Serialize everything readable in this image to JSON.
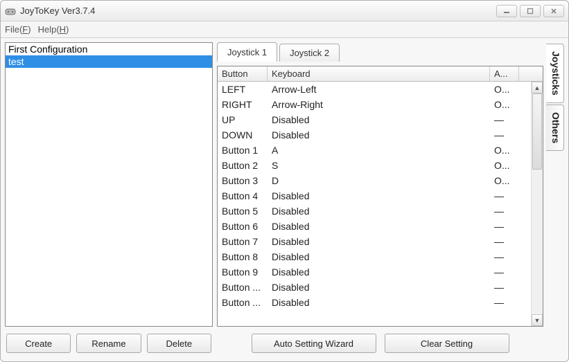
{
  "window": {
    "title": "JoyToKey Ver3.7.4"
  },
  "menu": {
    "file": "File(F)",
    "help": "Help(H)"
  },
  "configs": {
    "items": [
      {
        "label": "First Configuration",
        "selected": false
      },
      {
        "label": "test",
        "selected": true
      }
    ]
  },
  "left_buttons": {
    "create": "Create",
    "rename": "Rename",
    "delete": "Delete"
  },
  "tabs": {
    "joystick1": "Joystick 1",
    "joystick2": "Joystick 2"
  },
  "table": {
    "headers": {
      "button": "Button",
      "keyboard": "Keyboard",
      "a": "A..."
    },
    "rows": [
      {
        "button": "LEFT",
        "keyboard": "Arrow-Left",
        "a": "O..."
      },
      {
        "button": "RIGHT",
        "keyboard": "Arrow-Right",
        "a": "O..."
      },
      {
        "button": "UP",
        "keyboard": "Disabled",
        "a": "―"
      },
      {
        "button": "DOWN",
        "keyboard": "Disabled",
        "a": "―"
      },
      {
        "button": "Button 1",
        "keyboard": "A",
        "a": "O..."
      },
      {
        "button": "Button 2",
        "keyboard": "S",
        "a": "O..."
      },
      {
        "button": "Button 3",
        "keyboard": "D",
        "a": "O..."
      },
      {
        "button": "Button 4",
        "keyboard": "Disabled",
        "a": "―"
      },
      {
        "button": "Button 5",
        "keyboard": "Disabled",
        "a": "―"
      },
      {
        "button": "Button 6",
        "keyboard": "Disabled",
        "a": "―"
      },
      {
        "button": "Button 7",
        "keyboard": "Disabled",
        "a": "―"
      },
      {
        "button": "Button 8",
        "keyboard": "Disabled",
        "a": "―"
      },
      {
        "button": "Button 9",
        "keyboard": "Disabled",
        "a": "―"
      },
      {
        "button": "Button ...",
        "keyboard": "Disabled",
        "a": "―"
      },
      {
        "button": "Button ...",
        "keyboard": "Disabled",
        "a": "―"
      }
    ]
  },
  "right_buttons": {
    "wizard": "Auto Setting Wizard",
    "clear": "Clear Setting"
  },
  "side_tabs": {
    "joysticks": "Joysticks",
    "others": "Others"
  }
}
